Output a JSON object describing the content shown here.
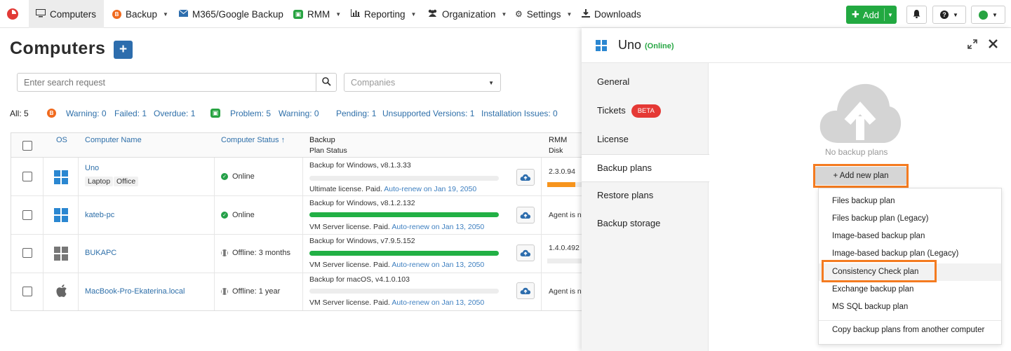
{
  "nav": {
    "items": [
      {
        "label": "Computers",
        "icon": "monitor-icon"
      },
      {
        "label": "Backup",
        "icon": "backup-icon"
      },
      {
        "label": "M365/Google Backup",
        "icon": "envelope-icon"
      },
      {
        "label": "RMM",
        "icon": "rmm-icon"
      },
      {
        "label": "Reporting",
        "icon": "bar-chart-icon"
      },
      {
        "label": "Organization",
        "icon": "users-icon"
      },
      {
        "label": "Settings",
        "icon": "gear-icon"
      },
      {
        "label": "Downloads",
        "icon": "download-icon"
      }
    ],
    "add_label": "Add"
  },
  "page": {
    "title": "Computers",
    "search_placeholder": "Enter search request",
    "companies_placeholder": "Companies"
  },
  "stats": {
    "all": "All: 5",
    "warning": "Warning: 0",
    "failed": "Failed: 1",
    "overdue": "Overdue: 1",
    "problem": "Problem: 5",
    "warning2": "Warning: 0",
    "pending": "Pending: 1",
    "unsupported": "Unsupported Versions: 1",
    "installation": "Installation Issues: 0"
  },
  "table": {
    "headers": {
      "os": "OS",
      "name": "Computer Name",
      "status": "Computer Status ↑",
      "backup": "Backup",
      "plan_status": "Plan Status",
      "rmm": "RMM",
      "disk": "Disk"
    },
    "rows": [
      {
        "name": "Uno",
        "tags": [
          "Laptop",
          "Office"
        ],
        "status": "Online",
        "backup": "Backup for Windows, v8.1.3.33",
        "license": "Ultimate license. Paid.",
        "autorenew": "Auto-renew on Jan 19, 2050",
        "rmm": "2.3.0.94",
        "progress": 0
      },
      {
        "name": "kateb-pc",
        "tags": [],
        "status": "Online",
        "backup": "Backup for Windows, v8.1.2.132",
        "license": "VM Server license. Paid.",
        "autorenew": "Auto-renew on Jan 13, 2050",
        "rmm": "Agent is no",
        "progress": 1
      },
      {
        "name": "BUKAPC",
        "tags": [],
        "status": "Offline: 3 months",
        "backup": "Backup for Windows, v7.9.5.152",
        "license": "VM Server license. Paid.",
        "autorenew": "Auto-renew on Jan 13, 2050",
        "rmm": "1.4.0.492",
        "progress": 1
      },
      {
        "name": "MacBook-Pro-Ekaterina.local",
        "tags": [],
        "status": "Offline: 1 year",
        "backup": "Backup for macOS, v4.1.0.103",
        "license": "VM Server license. Paid.",
        "autorenew": "Auto-renew on Jan 13, 2050",
        "rmm": "Agent is no",
        "progress": 0
      }
    ]
  },
  "panel": {
    "title": "Uno",
    "online": "(Online)",
    "tabs": [
      "General",
      "Tickets",
      "License",
      "Backup plans",
      "Restore plans",
      "Backup storage"
    ],
    "beta": "BETA",
    "no_plans": "No backup plans",
    "add_plan": "+ Add new plan",
    "menu": [
      "Files backup plan",
      "Files backup plan (Legacy)",
      "Image-based backup plan",
      "Image-based backup plan (Legacy)",
      "Consistency Check plan",
      "Exchange backup plan",
      "MS SQL backup plan",
      "Copy backup plans from another computer"
    ]
  },
  "colors": {
    "accent": "#2d6dad",
    "add": "#22a941",
    "highlight": "#f47b20",
    "online": "#28a745"
  }
}
